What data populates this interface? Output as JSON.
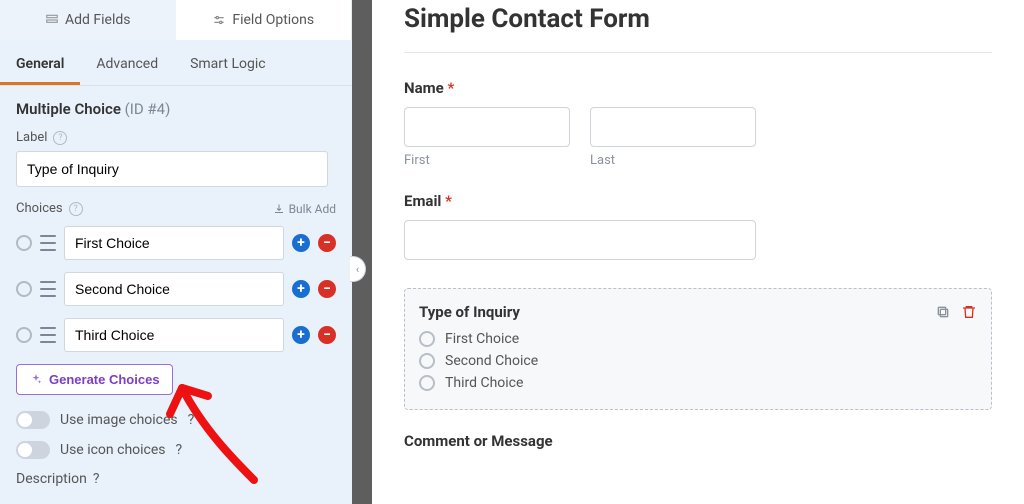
{
  "sidebar": {
    "top_tabs": {
      "add_fields": "Add Fields",
      "field_options": "Field Options"
    },
    "sub_tabs": {
      "general": "General",
      "advanced": "Advanced",
      "smart_logic": "Smart Logic"
    },
    "field_name": "Multiple Choice",
    "field_id": "(ID #4)",
    "label_label": "Label",
    "label_value": "Type of Inquiry",
    "choices_label": "Choices",
    "bulk_add": "Bulk Add",
    "choices": [
      "First Choice",
      "Second Choice",
      "Third Choice"
    ],
    "generate": "Generate Choices",
    "use_image": "Use image choices",
    "use_icon": "Use icon choices",
    "description_label": "Description"
  },
  "preview": {
    "title": "Simple Contact Form",
    "name_label": "Name",
    "first_sub": "First",
    "last_sub": "Last",
    "email_label": "Email",
    "inquiry_label": "Type of Inquiry",
    "options": [
      "First Choice",
      "Second Choice",
      "Third Choice"
    ],
    "comment_label": "Comment or Message"
  }
}
